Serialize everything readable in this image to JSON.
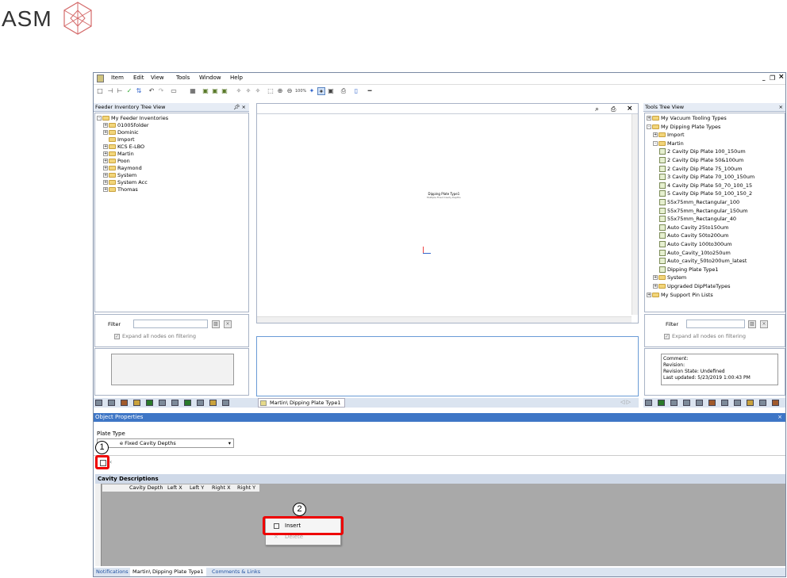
{
  "logo": {
    "text": "ASM"
  },
  "menu": [
    "Item",
    "Edit",
    "View",
    "Tools",
    "Window",
    "Help"
  ],
  "window_controls": {
    "minimize": "_",
    "restore": "Š",
    "close": "×"
  },
  "toolbar": {
    "zoom_100": "100%"
  },
  "left_panel": {
    "title": "Feeder Inventory Tree View",
    "pin": "$ ×",
    "root": "My Feeder Inventories",
    "items": [
      "01005folder",
      "Dominic",
      "Import",
      "KCS E-LBO",
      "Martin",
      "Poon",
      "Raymond",
      "System",
      "System Acc",
      "Thomas"
    ],
    "filter_label": "Filter",
    "expand_label": "Expand all nodes on filtering"
  },
  "center_panel": {
    "canvas_title": "Dipping Plate Type1",
    "canvas_subtitle": "Multiple Fixed Cavity Depths",
    "tab_label": "Martin\\ Dipping Plate Type1"
  },
  "right_panel": {
    "title": "Tools Tree View",
    "items": [
      {
        "label": "My Vacuum Tooling Types",
        "indent": 0,
        "kind": "folder"
      },
      {
        "label": "My Dipping Plate Types",
        "indent": 0,
        "kind": "folder"
      },
      {
        "label": "Import",
        "indent": 1,
        "kind": "folder"
      },
      {
        "label": "Martin",
        "indent": 1,
        "kind": "folder"
      },
      {
        "label": "2 Cavity Dip Plate 100_150um",
        "indent": 2,
        "kind": "plate"
      },
      {
        "label": "2 Cavity Dip Plate 50&100um",
        "indent": 2,
        "kind": "plate"
      },
      {
        "label": "2 Cavity Dip Plate 75_100um",
        "indent": 2,
        "kind": "plate"
      },
      {
        "label": "3 Cavity Dip Plate 70_100_150um",
        "indent": 2,
        "kind": "plate"
      },
      {
        "label": "4 Cavity Dip Plate 50_70_100_15",
        "indent": 2,
        "kind": "plate"
      },
      {
        "label": "5 Cavity Dip Plate 50_100_150_2",
        "indent": 2,
        "kind": "plate"
      },
      {
        "label": "55x75mm_Rectangular_100",
        "indent": 2,
        "kind": "plate"
      },
      {
        "label": "55x75mm_Rectangular_150um",
        "indent": 2,
        "kind": "plate"
      },
      {
        "label": "55x75mm_Rectangular_40",
        "indent": 2,
        "kind": "plate"
      },
      {
        "label": "Auto Cavity 25to150um",
        "indent": 2,
        "kind": "plate"
      },
      {
        "label": "Auto Cavity 50to200um",
        "indent": 2,
        "kind": "plate"
      },
      {
        "label": "Auto Cavity 100to300um",
        "indent": 2,
        "kind": "plate"
      },
      {
        "label": "Auto_Cavity_10to250um",
        "indent": 2,
        "kind": "plate"
      },
      {
        "label": "Auto_cavity_50to200um_latest",
        "indent": 2,
        "kind": "plate"
      },
      {
        "label": "Dipping Plate Type1",
        "indent": 2,
        "kind": "plate"
      },
      {
        "label": "System",
        "indent": 1,
        "kind": "folder"
      },
      {
        "label": "Upgraded DipPlateTypes",
        "indent": 1,
        "kind": "folder"
      },
      {
        "label": "My Support Pin Lists",
        "indent": 0,
        "kind": "folder"
      }
    ],
    "filter_label": "Filter",
    "expand_label": "Expand all nodes on filtering",
    "info": [
      "Comment:",
      "Revision:",
      "Revision State: Undefined",
      "Last updated: 5/23/2019 1:00:43 PM"
    ]
  },
  "properties": {
    "title": "Object Properties",
    "plate_type_label": "Plate Type",
    "plate_type_value": "e Fixed Cavity Depths",
    "section_title": "Cavity Descriptions",
    "columns": [
      "Cavity Depth",
      "Left X",
      "Left Y",
      "Right X",
      "Right Y"
    ],
    "context_menu": [
      "Insert",
      "Delete"
    ]
  },
  "bottom_tabs": [
    "Notifications",
    "Martin\\ Dipping Plate Type1",
    "Comments & Links"
  ],
  "callouts": [
    "1",
    "2"
  ],
  "colors": {
    "accent_red": "#e00000",
    "tab_blue": "#1e4fa0",
    "title_bar": "#3e76c6"
  }
}
